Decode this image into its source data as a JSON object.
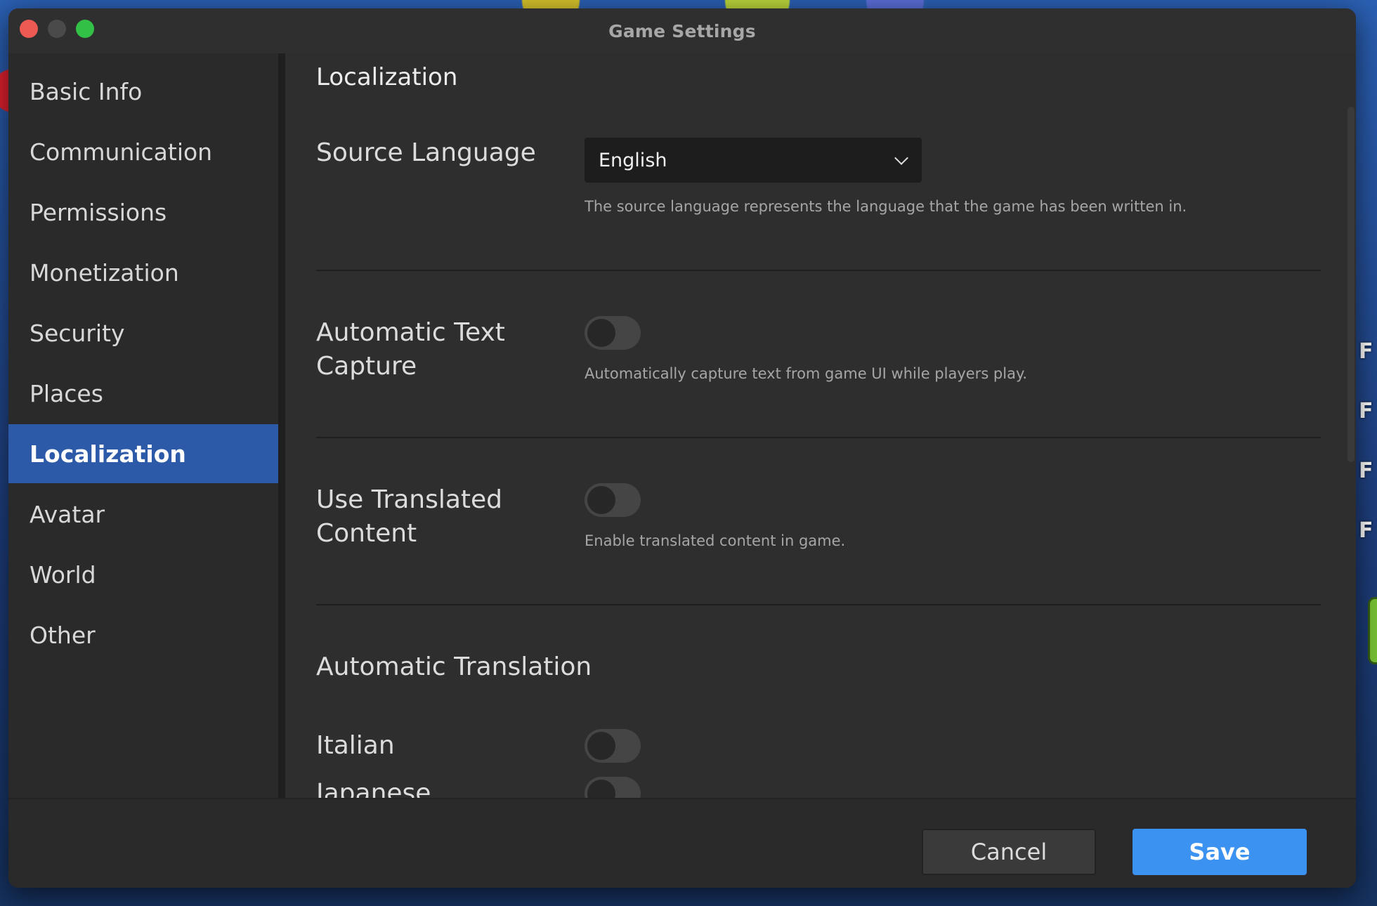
{
  "window": {
    "title": "Game Settings"
  },
  "sidebar": {
    "items": [
      {
        "label": "Basic Info"
      },
      {
        "label": "Communication"
      },
      {
        "label": "Permissions"
      },
      {
        "label": "Monetization"
      },
      {
        "label": "Security"
      },
      {
        "label": "Places"
      },
      {
        "label": "Localization",
        "active": true
      },
      {
        "label": "Avatar"
      },
      {
        "label": "World"
      },
      {
        "label": "Other"
      }
    ]
  },
  "content": {
    "section_title": "Localization",
    "source_language": {
      "label": "Source Language",
      "value": "English",
      "help": "The source language represents the language that the game has been written in."
    },
    "automatic_text_capture": {
      "label": "Automatic Text Capture",
      "enabled": false,
      "help": "Automatically capture text from game UI while players play."
    },
    "use_translated_content": {
      "label": "Use Translated Content",
      "enabled": false,
      "help": "Enable translated content in game."
    },
    "automatic_translation": {
      "title": "Automatic Translation",
      "languages": [
        {
          "label": "Italian",
          "enabled": false
        },
        {
          "label": "Japanese",
          "enabled": false
        }
      ]
    }
  },
  "footer": {
    "cancel_label": "Cancel",
    "save_label": "Save"
  },
  "colors": {
    "accent": "#3b92f0",
    "selected": "#2c5aa8"
  }
}
